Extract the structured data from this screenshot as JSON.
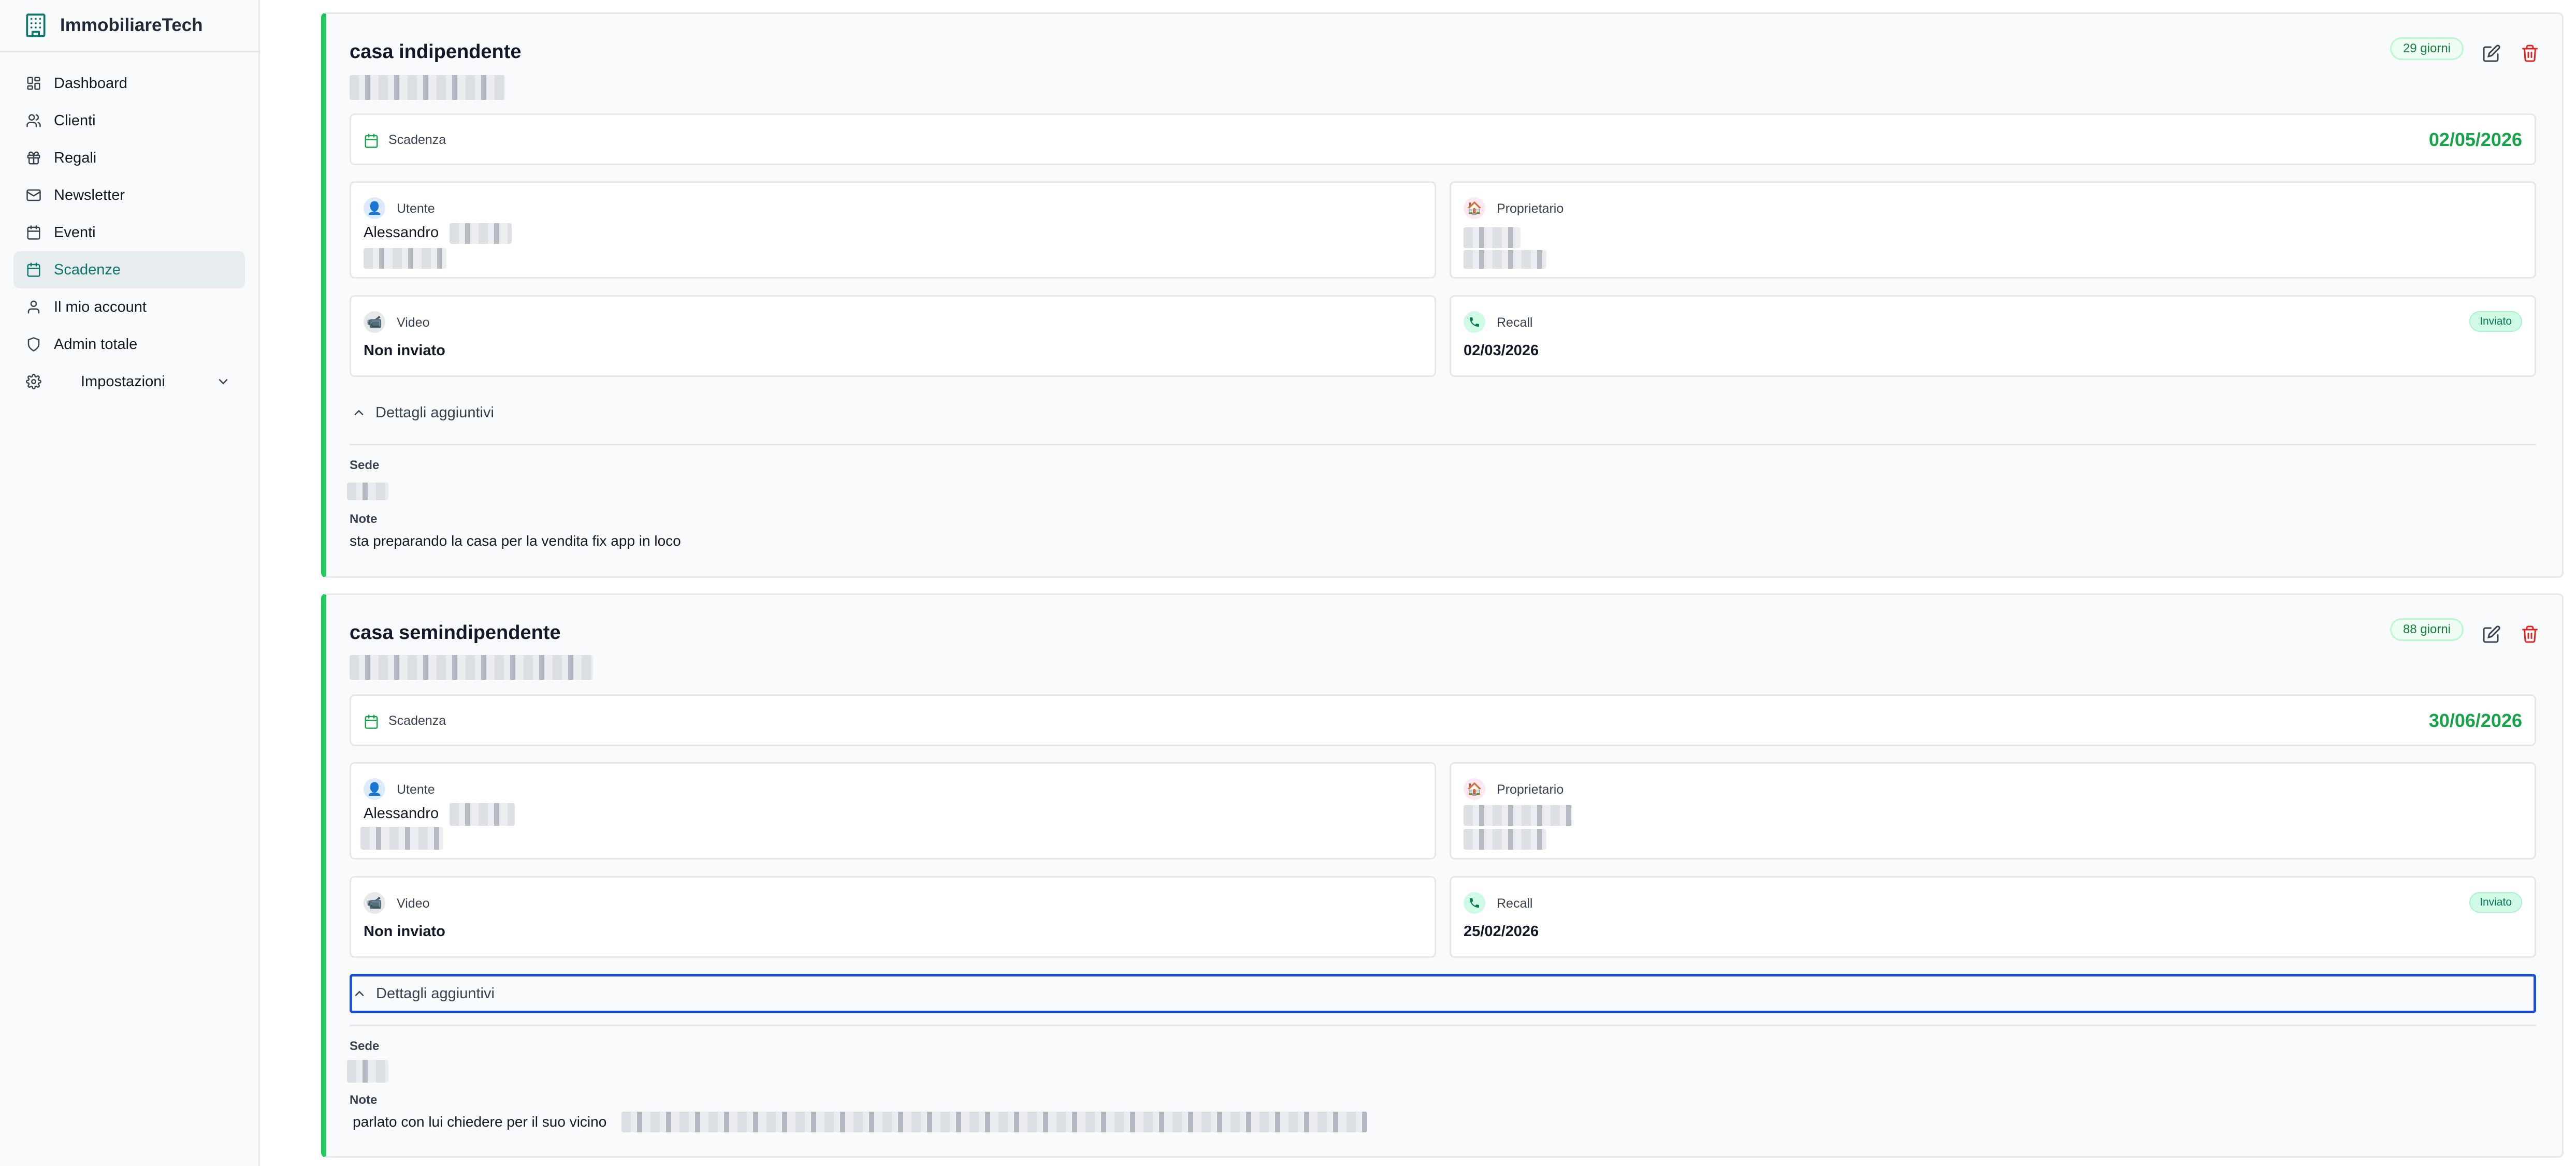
{
  "app": {
    "name": "ImmobiliareTech",
    "logo_icon": "building-icon"
  },
  "sidebar": {
    "items": [
      {
        "label": "Dashboard",
        "icon": "dashboard-icon"
      },
      {
        "label": "Clienti",
        "icon": "users-icon"
      },
      {
        "label": "Regali",
        "icon": "gift-icon"
      },
      {
        "label": "Newsletter",
        "icon": "mail-icon"
      },
      {
        "label": "Eventi",
        "icon": "calendar-icon"
      },
      {
        "label": "Scadenze",
        "icon": "calendar-icon",
        "active": true
      },
      {
        "label": "Il mio account",
        "icon": "user-icon"
      },
      {
        "label": "Admin totale",
        "icon": "shield-icon"
      },
      {
        "label": "Impostazioni",
        "icon": "gear-icon"
      }
    ]
  },
  "cards": [
    {
      "title": "casa indipendente",
      "days": "29 giorni",
      "deadline_label": "Scadenza",
      "deadline_date": "02/05/2026",
      "user_label": "Utente",
      "user_name": "Alessandro",
      "owner_label": "Proprietario",
      "video_label": "Video",
      "video_value": "Non inviato",
      "recall_label": "Recall",
      "recall_value": "02/03/2026",
      "recall_status": "Inviato",
      "details_label": "Dettagli aggiuntivi",
      "sede_label": "Sede",
      "note_label": "Note",
      "note_value": "sta preparando la casa per la vendita fix app in loco"
    },
    {
      "title": "casa semindipendente",
      "days": "88 giorni",
      "deadline_label": "Scadenza",
      "deadline_date": "30/06/2026",
      "user_label": "Utente",
      "user_name": "Alessandro",
      "owner_label": "Proprietario",
      "video_label": "Video",
      "video_value": "Non inviato",
      "recall_label": "Recall",
      "recall_value": "25/02/2026",
      "recall_status": "Inviato",
      "details_label": "Dettagli aggiuntivi",
      "sede_label": "Sede",
      "note_label": "Note",
      "note_value": "parlato  con lui chiedere per il suo vicino"
    }
  ],
  "colors": {
    "accent": "#22c55e",
    "date_green": "#16a34a",
    "active_nav_text": "#0f766e",
    "delete_red": "#dc2626",
    "focus_blue": "#1d4ed8"
  }
}
